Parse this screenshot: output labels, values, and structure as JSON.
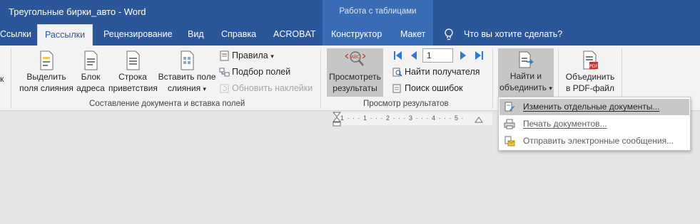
{
  "titlebar": {
    "document_title": "Треугольные бирки_авто  -  Word",
    "contextual_group": "Работа с таблицами"
  },
  "tabs": [
    {
      "label": "Ссылки",
      "active": false
    },
    {
      "label": "Рассылки",
      "active": true
    },
    {
      "label": "Рецензирование",
      "active": false
    },
    {
      "label": "Вид",
      "active": false
    },
    {
      "label": "Справка",
      "active": false
    },
    {
      "label": "ACROBAT",
      "active": false
    },
    {
      "label": "Конструктор",
      "active": false
    },
    {
      "label": "Макет",
      "active": false
    }
  ],
  "tell_me": {
    "placeholder": "Что вы хотите сделать?"
  },
  "ribbon": {
    "partial_left_label": "к",
    "compose_group": {
      "label": "Составление документа и вставка полей",
      "highlight_merge_fields": {
        "line1": "Выделить",
        "line2": "поля слияния"
      },
      "address_block": {
        "line1": "Блок",
        "line2": "адреса"
      },
      "greeting_line": {
        "line1": "Строка",
        "line2": "приветствия"
      },
      "insert_merge_field": {
        "line1": "Вставить поле",
        "line2": "слияния",
        "arrow": "▾"
      },
      "rules": {
        "label": "Правила",
        "arrow": "▾"
      },
      "match_fields": "Подбор полей",
      "update_labels": "Обновить наклейки"
    },
    "preview_group": {
      "label": "Просмотр результатов",
      "preview_results": {
        "line1": "Просмотреть",
        "line2": "результаты"
      },
      "record_number": "1",
      "find_recipient": "Найти получателя",
      "check_errors": "Поиск ошибок"
    },
    "finish_group": {
      "finish_merge": {
        "line1": "Найти и",
        "line2": "объединить",
        "arrow": "▾"
      }
    },
    "acrobat_group": {
      "merge_pdf": {
        "line1": "Объединить",
        "line2": "в PDF-файл"
      }
    }
  },
  "ruler": {
    "ticks": "1 · · · 1 · · · 2 · · · 3 · · · 4 · · · 5 ·"
  },
  "dropdown": {
    "items": [
      {
        "label": "Изменить отдельные документы...",
        "icon": "edit-documents-icon"
      },
      {
        "label": "Печать документов...",
        "icon": "print-documents-icon"
      },
      {
        "label": "Отправить электронные сообщения...",
        "icon": "send-email-icon"
      }
    ]
  },
  "colors": {
    "title_blue": "#2b579a",
    "contextual_blue": "#3a6cb6",
    "ribbon_bg": "#f3f3f3",
    "pressed_gray": "#c6c6c6",
    "canvas_gray": "#e6e6e6"
  }
}
